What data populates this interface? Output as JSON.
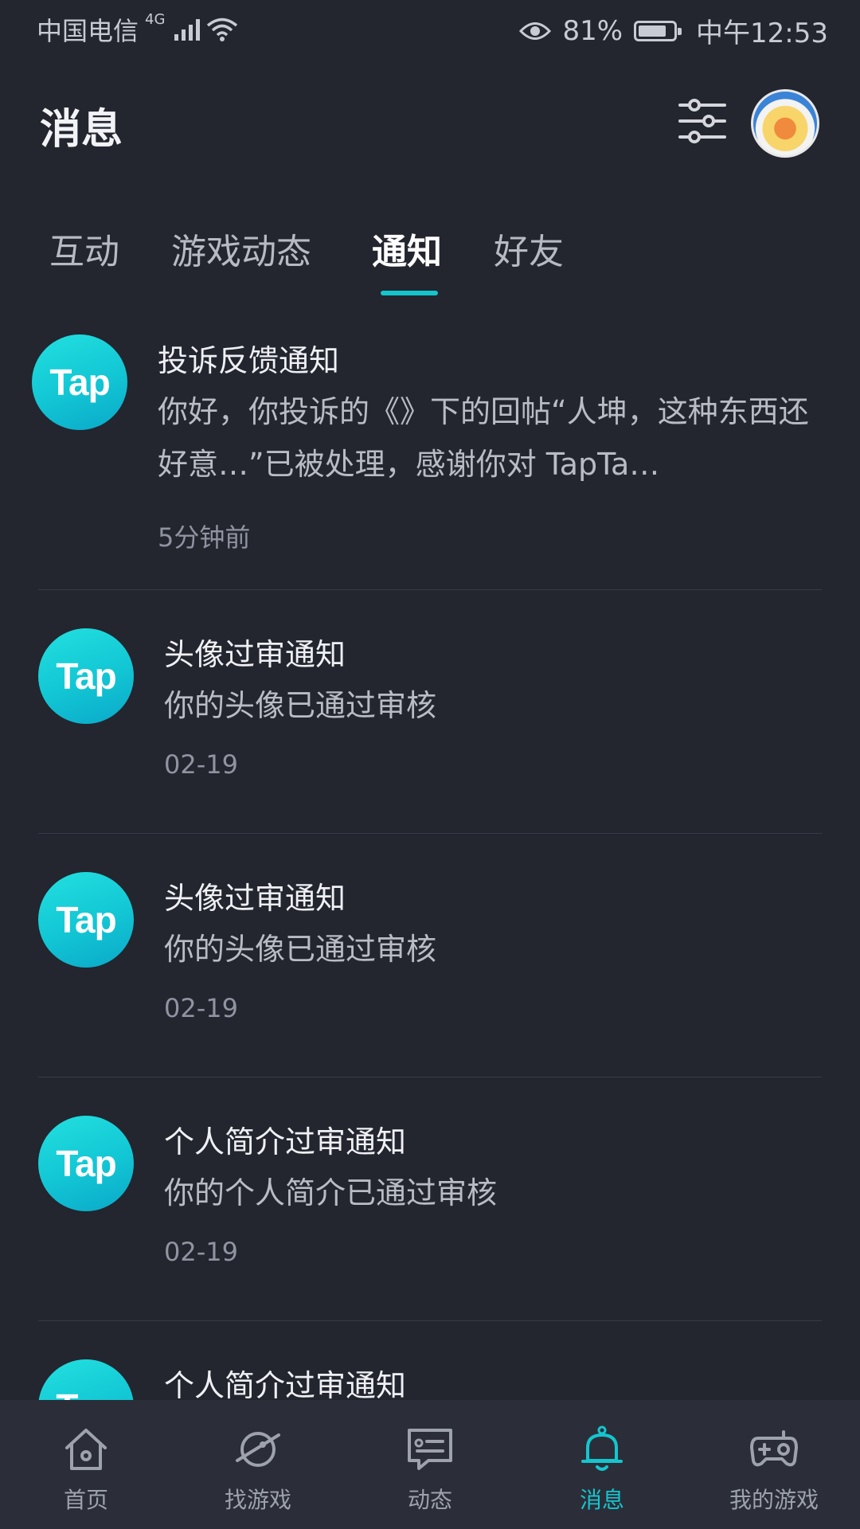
{
  "status_bar": {
    "carrier": "中国电信",
    "network": "4G",
    "battery": "81%",
    "battery_level": 0.81,
    "time": "中午12:53"
  },
  "header": {
    "title": "消息"
  },
  "tabs": [
    {
      "label": "互动"
    },
    {
      "label": "游戏动态"
    },
    {
      "label": "通知",
      "active": true
    },
    {
      "label": "好友"
    }
  ],
  "notifications": [
    {
      "logo_text": "Tap",
      "title": "投诉反馈通知",
      "body": "你好，你投诉的《》下的回帖“人坤，这种东西还好意…”已被处理，感谢你对 TapTa…",
      "time": "5分钟前"
    },
    {
      "logo_text": "Tap",
      "title": "头像过审通知",
      "body": "你的头像已通过审核",
      "time": "02-19"
    },
    {
      "logo_text": "Tap",
      "title": "头像过审通知",
      "body": "你的头像已通过审核",
      "time": "02-19"
    },
    {
      "logo_text": "Tap",
      "title": "个人简介过审通知",
      "body": "你的个人简介已通过审核",
      "time": "02-19"
    },
    {
      "logo_text": "Tap",
      "title": "个人简介过审通知"
    }
  ],
  "bottom_nav": [
    {
      "label": "首页",
      "icon": "home-icon"
    },
    {
      "label": "找游戏",
      "icon": "planet-icon"
    },
    {
      "label": "动态",
      "icon": "feed-icon"
    },
    {
      "label": "消息",
      "icon": "bell-icon",
      "active": true
    },
    {
      "label": "我的游戏",
      "icon": "gamepad-icon"
    }
  ],
  "colors": {
    "background": "#23252f",
    "accent": "#15c5ce",
    "nav_background": "#2b2e39"
  }
}
